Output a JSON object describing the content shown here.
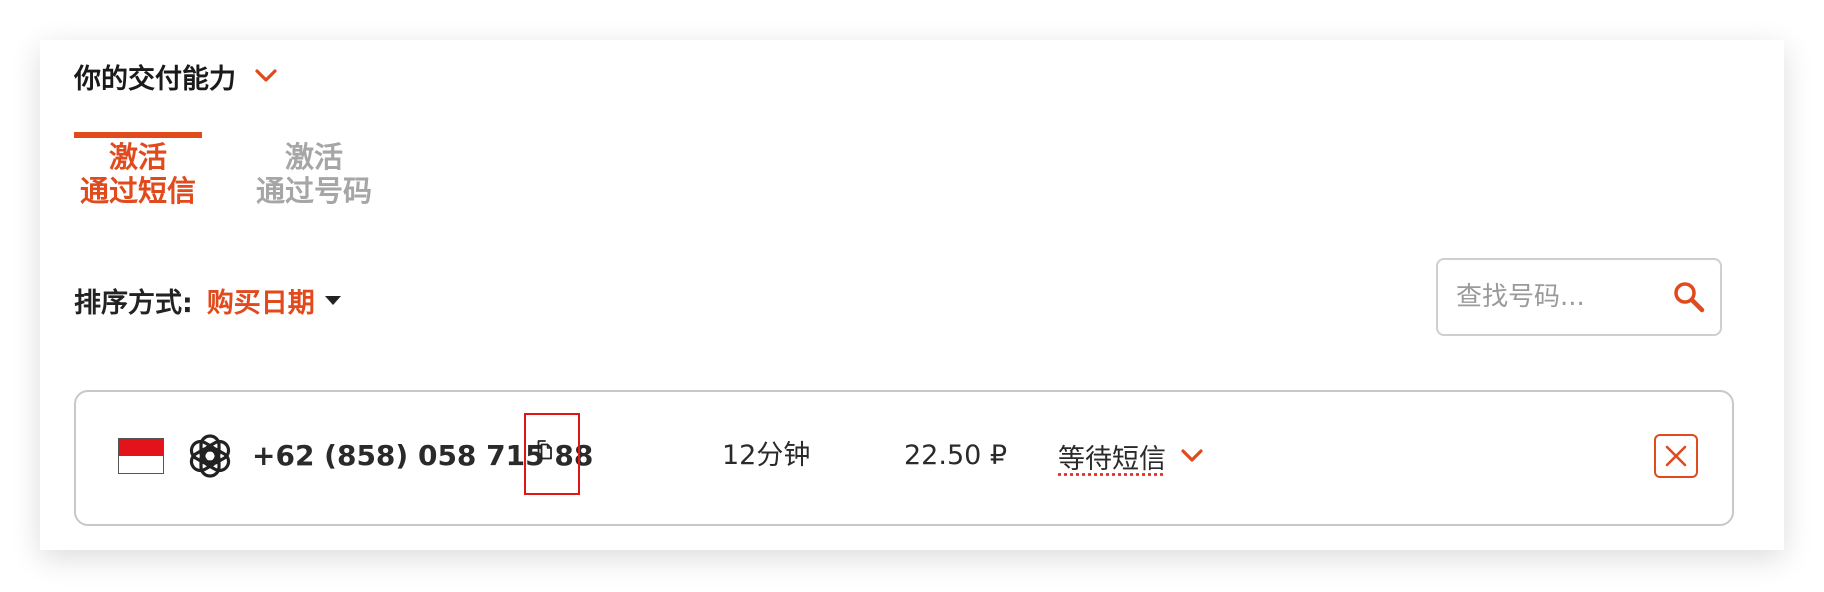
{
  "header": {
    "title": "你的交付能力"
  },
  "tabs": [
    {
      "line1": "激活",
      "line2": "通过短信",
      "active": true
    },
    {
      "line1": "激活",
      "line2": "通过号码",
      "active": false
    }
  ],
  "sort": {
    "label": "排序方式:",
    "value": "购买日期"
  },
  "search": {
    "placeholder": "查找号码..."
  },
  "order": {
    "country_flag": "indonesia-flag",
    "service_icon": "openai-icon",
    "phone": "+62 (858) 058 715 88",
    "duration": "12分钟",
    "price": "22.50 ₽",
    "status": "等待短信"
  },
  "colors": {
    "accent": "#e04a1c",
    "text": "#222222",
    "muted": "#a6a6a6",
    "highlight_box": "#e01515"
  }
}
